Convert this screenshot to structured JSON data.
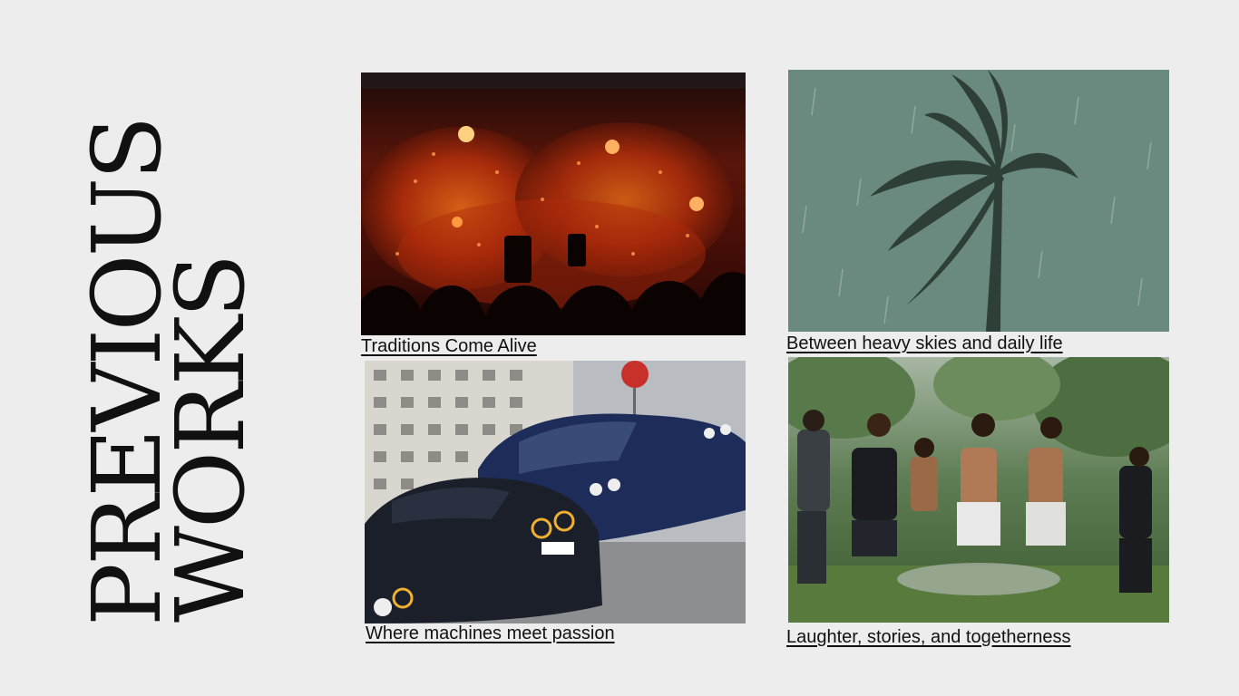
{
  "title": {
    "line1": "PREVIOUS",
    "line2": "WORKS"
  },
  "works": [
    {
      "caption": "Traditions Come Alive",
      "image": "fire-festival-photo"
    },
    {
      "caption": "Between heavy skies and daily life",
      "image": "palm-tree-rain-photo"
    },
    {
      "caption": "Where machines meet passion",
      "image": "muscle-cars-photo"
    },
    {
      "caption": "Laughter, stories, and togetherness",
      "image": "friends-dancing-rain-photo"
    }
  ],
  "colors": {
    "background": "#ededed",
    "text": "#111111"
  }
}
